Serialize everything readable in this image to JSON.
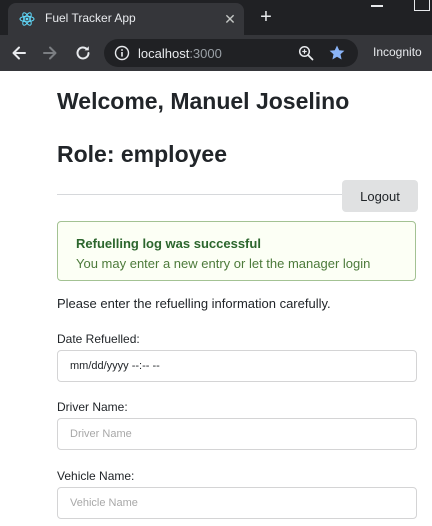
{
  "browser": {
    "tab_title": "Fuel Tracker App",
    "url_host": "localhost",
    "url_port": ":3000",
    "mode_label": "Incognito",
    "accent_color": "#8ab4f8"
  },
  "header": {
    "welcome": "Welcome, Manuel Joselino",
    "role": "Role: employee",
    "logout_label": "Logout"
  },
  "alert": {
    "title": "Refuelling log was successful",
    "message": "You may enter a new entry or let the manager login",
    "color": "#a3c293"
  },
  "form": {
    "intro": "Please enter the refuelling information carefully.",
    "date": {
      "label": "Date Refuelled:",
      "value": "mm/dd/yyyy --:-- --"
    },
    "driver": {
      "label": "Driver Name:",
      "placeholder": "Driver Name"
    },
    "vehicle": {
      "label": "Vehicle Name:",
      "placeholder": "Vehicle Name"
    }
  }
}
